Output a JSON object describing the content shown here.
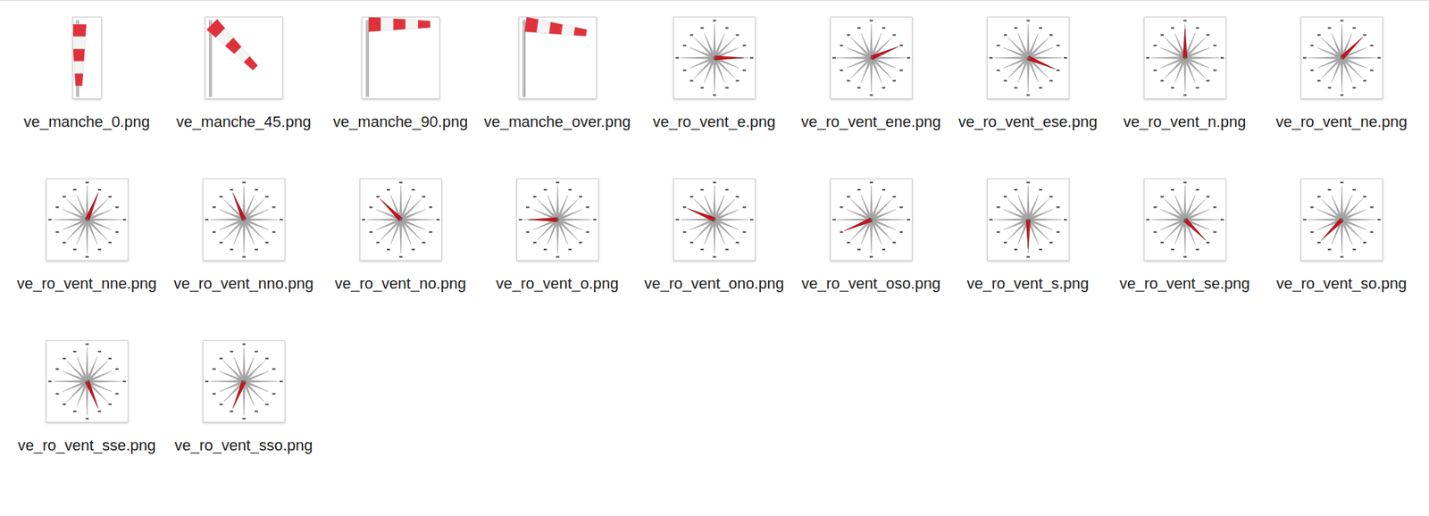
{
  "window": {
    "view": "icons"
  },
  "files": [
    {
      "name": "ve_manche_0.png",
      "kind": "windsock",
      "angle": 0,
      "selected": false
    },
    {
      "name": "ve_manche_45.png",
      "kind": "windsock",
      "angle": 45,
      "selected": false
    },
    {
      "name": "ve_manche_90.png",
      "kind": "windsock",
      "angle": 90,
      "selected": false
    },
    {
      "name": "ve_manche_over.png",
      "kind": "windsock",
      "angle": 82,
      "selected": false
    },
    {
      "name": "ve_ro_vent_e.png",
      "kind": "compass",
      "angle": 90,
      "selected": false
    },
    {
      "name": "ve_ro_vent_ene.png",
      "kind": "compass",
      "angle": 67.5,
      "selected": false
    },
    {
      "name": "ve_ro_vent_ese.png",
      "kind": "compass",
      "angle": 112.5,
      "selected": false
    },
    {
      "name": "ve_ro_vent_n.png",
      "kind": "compass",
      "angle": 0,
      "selected": false
    },
    {
      "name": "ve_ro_vent_ne.png",
      "kind": "compass",
      "angle": 45,
      "selected": false
    },
    {
      "name": "ve_ro_vent_nne.png",
      "kind": "compass",
      "angle": 22.5,
      "selected": false
    },
    {
      "name": "ve_ro_vent_nno.png",
      "kind": "compass",
      "angle": 337.5,
      "selected": false
    },
    {
      "name": "ve_ro_vent_no.png",
      "kind": "compass",
      "angle": 315,
      "selected": false
    },
    {
      "name": "ve_ro_vent_o.png",
      "kind": "compass",
      "angle": 270,
      "selected": false
    },
    {
      "name": "ve_ro_vent_ono.png",
      "kind": "compass",
      "angle": 292.5,
      "selected": false
    },
    {
      "name": "ve_ro_vent_oso.png",
      "kind": "compass",
      "angle": 247.5,
      "selected": false
    },
    {
      "name": "ve_ro_vent_s.png",
      "kind": "compass",
      "angle": 180,
      "selected": false
    },
    {
      "name": "ve_ro_vent_se.png",
      "kind": "compass",
      "angle": 135,
      "selected": false
    },
    {
      "name": "ve_ro_vent_so.png",
      "kind": "compass",
      "angle": 225,
      "selected": false
    },
    {
      "name": "ve_ro_vent_sse.png",
      "kind": "compass",
      "angle": 157.5,
      "selected": false
    },
    {
      "name": "ve_ro_vent_sso.png",
      "kind": "compass",
      "angle": 202.5,
      "selected": false
    }
  ]
}
